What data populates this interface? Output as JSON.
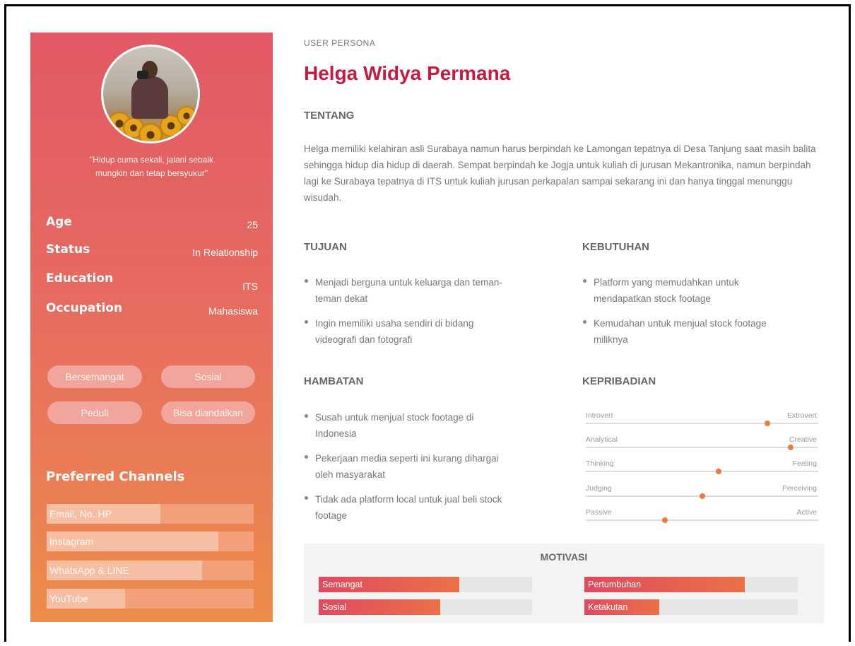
{
  "persona": {
    "eyebrow": "USER PERSONA",
    "name": "Helga Widya Permana",
    "quote_line1": "\"Hidup cuma sekali, jalani sebaik",
    "quote_line2": "mungkin dan tetap bersyukur\""
  },
  "info": {
    "age_label": "Age",
    "age_value": "25",
    "status_label": "Status",
    "status_value": "In Relationship",
    "education_label": "Education",
    "education_value": "ITS",
    "occupation_label": "Occupation",
    "occupation_value": "Mahasiswa"
  },
  "tags": [
    "Bersemangat",
    "Sosial",
    "Peduli",
    "Bisa diandalkan"
  ],
  "channels": {
    "title": "Preferred Channels",
    "items": [
      {
        "label": "Email, No. HP",
        "level": 0.55
      },
      {
        "label": "Instagram",
        "level": 0.83
      },
      {
        "label": "WhatsApp & LINE",
        "level": 0.75
      },
      {
        "label": "YouTube",
        "level": 0.38
      }
    ]
  },
  "tentang": {
    "title": "TENTANG",
    "text": "Helga memiliki kelahiran asli Surabaya namun harus berpindah ke Lamongan tepatnya di Desa Tanjung saat masih balita sehingga hidup dia hidup di daerah. Sempat berpindah ke Jogja untuk kuliah di jurusan Mekantronika, namun berpindah lagi ke Surabaya tepatnya di ITS untuk kuliah jurusan perkapalan sampai sekarang ini dan hanya tinggal menunggu wisudah."
  },
  "tujuan": {
    "title": "TUJUAN",
    "items": [
      "Menjadi berguna untuk keluarga dan teman-teman dekat",
      "Ingin memiliki usaha sendiri di bidang videografi dan fotografi"
    ]
  },
  "kebutuhan": {
    "title": "KEBUTUHAN",
    "items": [
      "Platform yang memudahkan untuk mendapatkan stock footage",
      "Kemudahan untuk menjual stock footage miliknya"
    ]
  },
  "hambatan": {
    "title": "HAMBATAN",
    "items": [
      "Susah untuk menjual stock footage di Indonesia",
      "Pekerjaan media seperti ini kurang dihargai oleh masyarakat",
      "Tidak ada platform local untuk jual beli stock footage"
    ]
  },
  "kepribadian": {
    "title": "KEPRIBADIAN",
    "traits": [
      {
        "left": "Introvert",
        "right": "Extrovert",
        "value": 0.78
      },
      {
        "left": "Analytical",
        "right": "Creative",
        "value": 0.88
      },
      {
        "left": "Thinking",
        "right": "Feeling",
        "value": 0.57
      },
      {
        "left": "Judging",
        "right": "Perceiving",
        "value": 0.5
      },
      {
        "left": "Passive",
        "right": "Active",
        "value": 0.34
      }
    ]
  },
  "motivasi": {
    "title": "MOTIVASI",
    "items": [
      {
        "label": "Semangat",
        "level": 0.66
      },
      {
        "label": "Pertumbuhan",
        "level": 0.75
      },
      {
        "label": "Sosial",
        "level": 0.57
      },
      {
        "label": "Ketakutan",
        "level": 0.35
      }
    ]
  },
  "colors": {
    "accent": "#c8193e",
    "slider_dot": "#ec7d36"
  }
}
